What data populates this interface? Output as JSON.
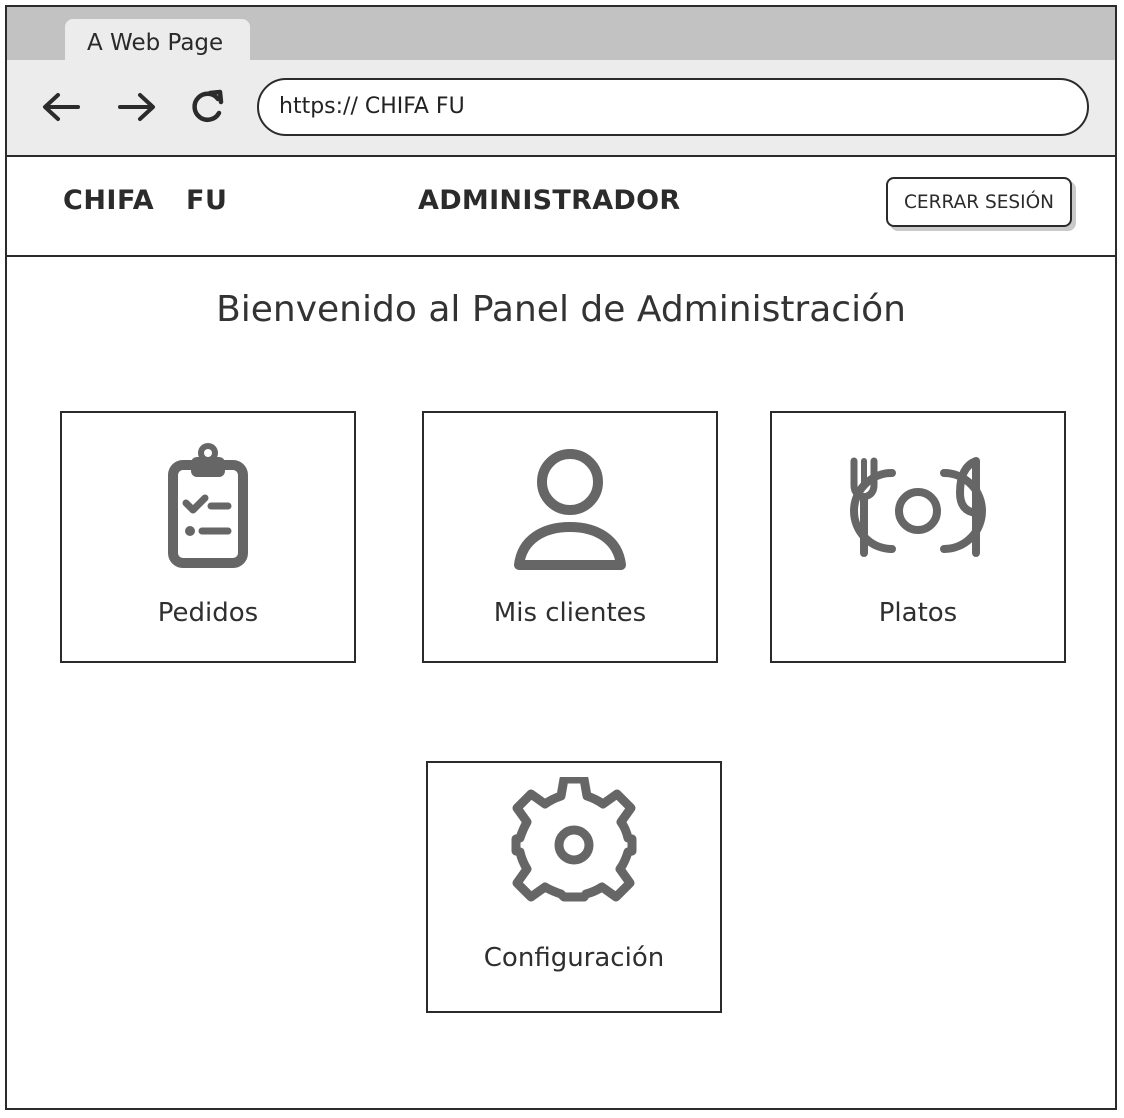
{
  "browser": {
    "tab_title": "A Web Page",
    "url": "https:// CHIFA FU"
  },
  "header": {
    "brand": "CHIFA  FU",
    "role": "ADMINISTRADOR",
    "logout_label": "CERRAR SESIÓN"
  },
  "main": {
    "title": "Bienvenido al Panel de Administración",
    "cards": [
      {
        "label": "Pedidos",
        "icon": "clipboard-checklist-icon"
      },
      {
        "label": "Mis clientes",
        "icon": "user-icon"
      },
      {
        "label": "Platos",
        "icon": "plate-cutlery-icon"
      },
      {
        "label": "Configuración",
        "icon": "gear-icon"
      }
    ]
  },
  "colors": {
    "icon": "#666666",
    "border": "#2b2b2b",
    "tab_strip": "#c2c2c2",
    "chrome": "#ececec"
  }
}
